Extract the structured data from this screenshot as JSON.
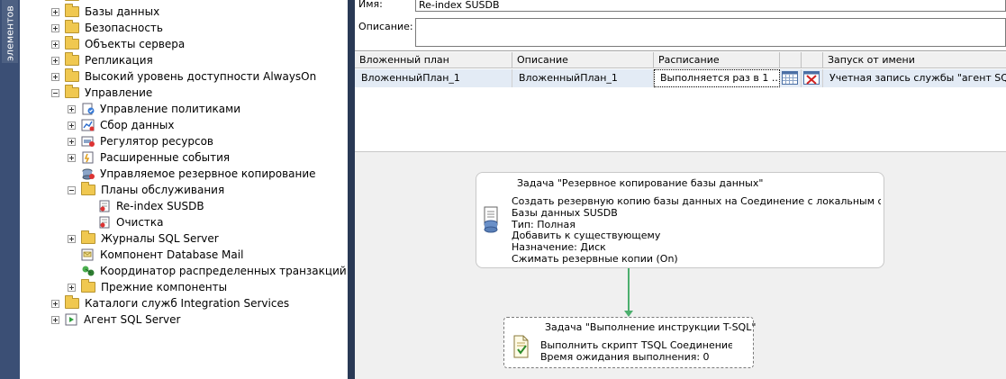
{
  "side_tab_label": "элементов",
  "tree": [
    {
      "label": "",
      "exp": "none",
      "icon": "folder-icon"
    },
    {
      "label": "Базы данных",
      "exp": "plus",
      "icon": "folder-icon"
    },
    {
      "label": "Безопасность",
      "exp": "plus",
      "icon": "folder-icon"
    },
    {
      "label": "Объекты сервера",
      "exp": "plus",
      "icon": "folder-icon"
    },
    {
      "label": "Репликация",
      "exp": "plus",
      "icon": "folder-icon"
    },
    {
      "label": "Высокий уровень доступности AlwaysOn",
      "exp": "plus",
      "icon": "folder-icon"
    },
    {
      "label": "Управление",
      "exp": "minus",
      "icon": "folder-icon"
    },
    {
      "label": "Управление политиками",
      "exp": "plus",
      "icon": "policy-icon"
    },
    {
      "label": "Сбор данных",
      "exp": "plus",
      "icon": "data-collection-icon"
    },
    {
      "label": "Регулятор ресурсов",
      "exp": "plus",
      "icon": "resource-governor-icon"
    },
    {
      "label": "Расширенные события",
      "exp": "plus",
      "icon": "extended-events-icon"
    },
    {
      "label": "Управляемое резервное копирование",
      "exp": "none",
      "icon": "managed-backup-icon"
    },
    {
      "label": "Планы обслуживания",
      "exp": "minus",
      "icon": "folder-icon"
    },
    {
      "label": "Re-index SUSDB",
      "exp": "none",
      "icon": "maintenance-plan-icon"
    },
    {
      "label": "Очистка",
      "exp": "none",
      "icon": "maintenance-plan-icon"
    },
    {
      "label": "Журналы SQL Server",
      "exp": "plus",
      "icon": "folder-icon"
    },
    {
      "label": "Компонент Database Mail",
      "exp": "none",
      "icon": "database-mail-icon"
    },
    {
      "label": "Координатор распределенных транзакций",
      "exp": "none",
      "icon": "dtc-icon"
    },
    {
      "label": "Прежние компоненты",
      "exp": "plus",
      "icon": "folder-icon"
    },
    {
      "label": "Каталоги служб Integration Services",
      "exp": "plus",
      "icon": "folder-icon"
    },
    {
      "label": "Агент SQL Server",
      "exp": "plus",
      "icon": "sql-agent-icon"
    }
  ],
  "props": {
    "name_label": "Имя:",
    "name_value": "Re-index SUSDB",
    "description_label": "Описание:",
    "description_value": ""
  },
  "grid": {
    "headers": [
      "Вложенный план",
      "Описание",
      "Расписание",
      "",
      "",
      "Запуск от имени"
    ],
    "row": {
      "subplan": "ВложенныйПлан_1",
      "description": "ВложенныйПлан_1",
      "schedule": "Выполняется раз в 1 ...",
      "run_as": "Учетная запись службы \"агент SQL Se"
    }
  },
  "tasks": [
    {
      "title": "Задача \"Резервное копирование базы данных\"",
      "lines": [
        "Создать резервную копию базы данных на Соединение с локальным сервером",
        "Базы данных SUSDB",
        "Тип: Полная",
        "Добавить к существующему",
        "Назначение: Диск",
        "Сжимать резервные копии (On)"
      ]
    },
    {
      "title": "Задача \"Выполнение инструкции T-SQL\"",
      "lines": [
        "Выполнить скрипт TSQL Соединение с локальным",
        "Время ожидания выполнения: 0"
      ]
    }
  ],
  "colors": {
    "selection_row": "#e3ebf5",
    "connector": "#4caf6e",
    "side_strip": "#3b4f75"
  }
}
